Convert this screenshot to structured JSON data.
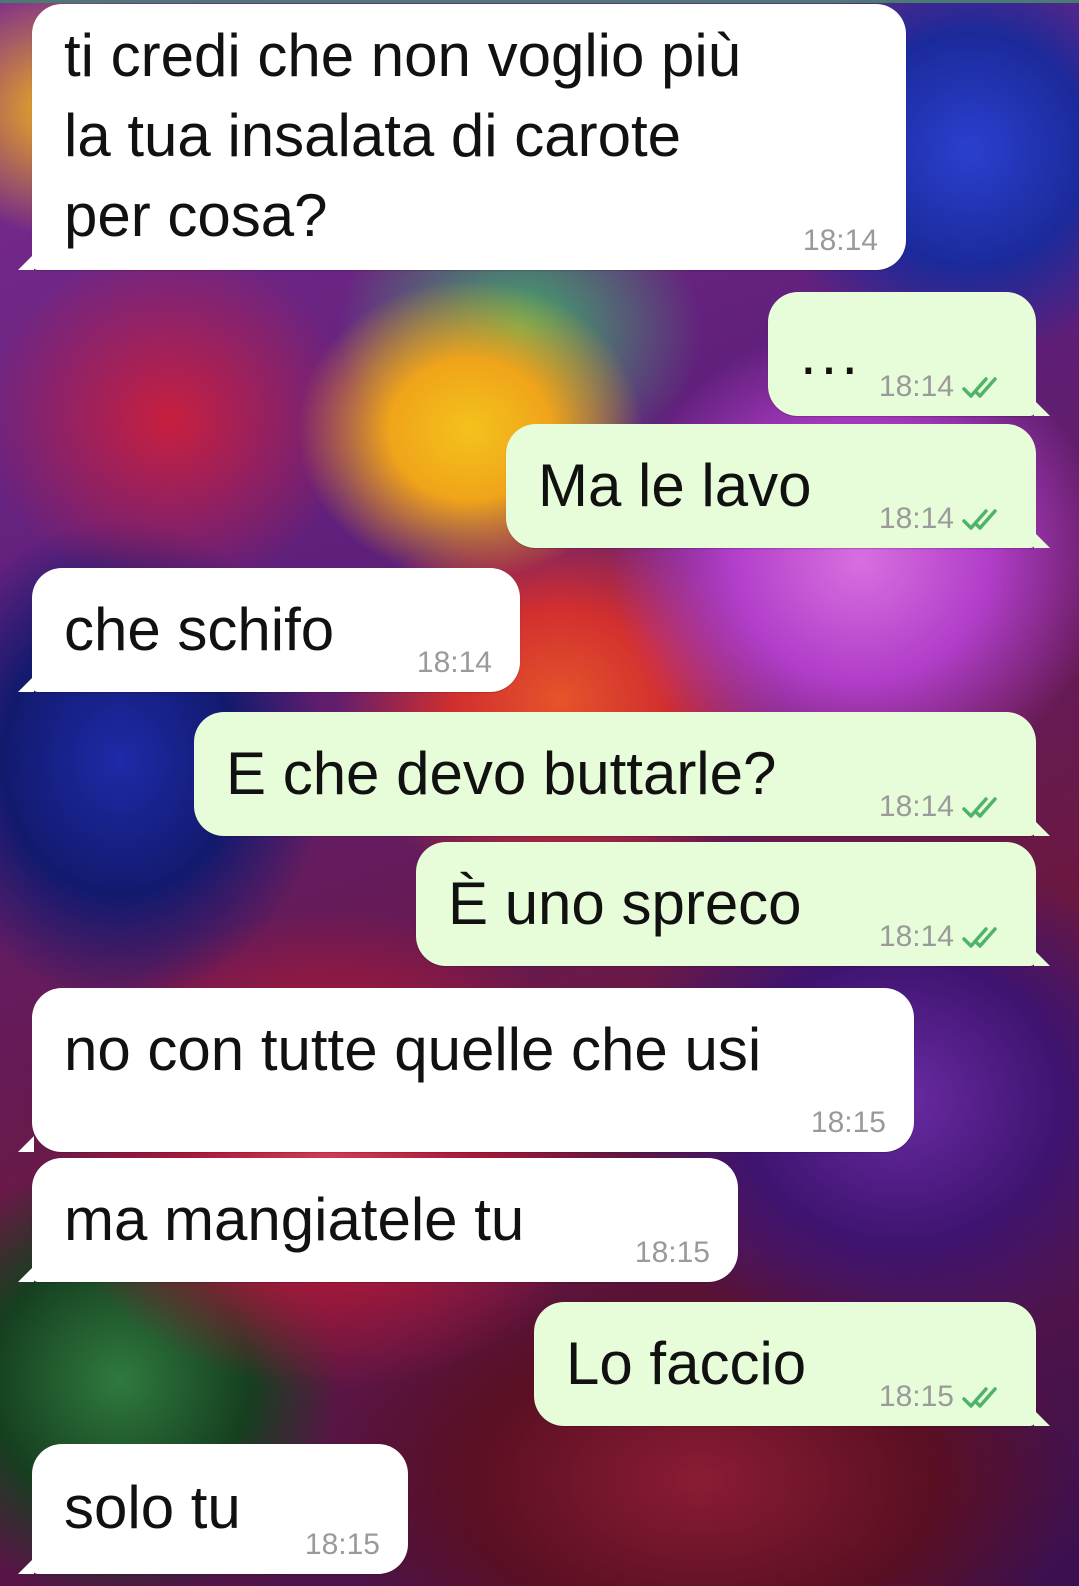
{
  "colors": {
    "incoming_bubble": "#ffffff",
    "outgoing_bubble": "#e7fcd8",
    "timestamp": "#9a9a9a",
    "read_ticks": "#4fb36a"
  },
  "messages": [
    {
      "direction": "incoming",
      "text_lines": [
        "ti credi che non voglio più",
        "la tua insalata di carote",
        "per cosa?"
      ],
      "time": "18:14"
    },
    {
      "direction": "outgoing",
      "text": "...",
      "time": "18:14",
      "status_icon": "double-check-icon"
    },
    {
      "direction": "outgoing",
      "text": "Ma le lavo",
      "time": "18:14",
      "status_icon": "double-check-icon"
    },
    {
      "direction": "incoming",
      "text": "che schifo",
      "time": "18:14"
    },
    {
      "direction": "outgoing",
      "text": "E che devo buttarle?",
      "time": "18:14",
      "status_icon": "double-check-icon"
    },
    {
      "direction": "outgoing",
      "text": "È uno spreco",
      "time": "18:14",
      "status_icon": "double-check-icon"
    },
    {
      "direction": "incoming",
      "text": "no con tutte quelle che usi",
      "time": "18:15"
    },
    {
      "direction": "incoming",
      "text": "ma mangiatele tu",
      "time": "18:15"
    },
    {
      "direction": "outgoing",
      "text": "Lo faccio",
      "time": "18:15",
      "status_icon": "double-check-icon"
    },
    {
      "direction": "incoming",
      "text": "solo tu",
      "time": "18:15"
    }
  ]
}
